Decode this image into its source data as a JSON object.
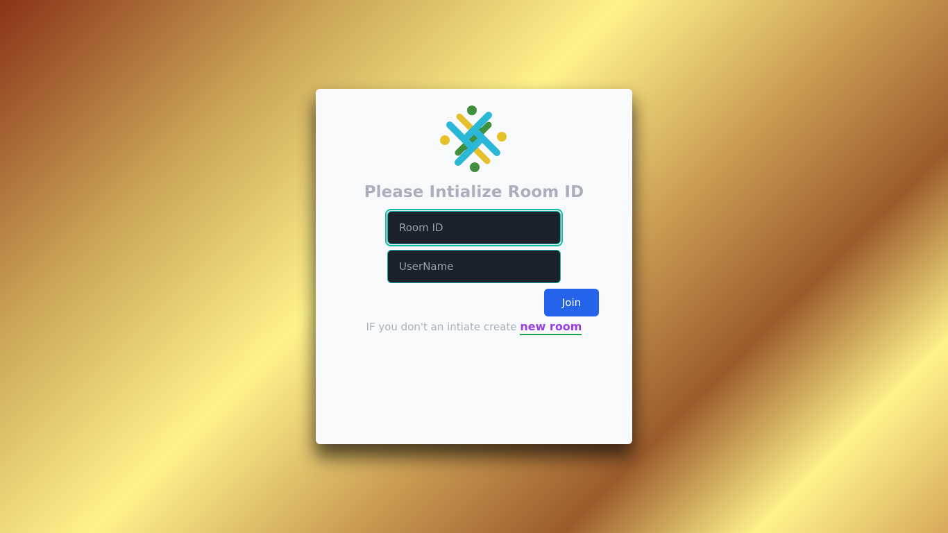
{
  "card": {
    "title": "Please Intialize Room ID",
    "room_id_placeholder": "Room ID",
    "username_placeholder": "UserName",
    "join_label": "Join",
    "hint_text": "IF you don't an intiate create",
    "hint_link": "new room"
  },
  "logo": {
    "icon": "people-circle-logo-icon",
    "colors": {
      "blue": "#2bb7d6",
      "green": "#3f8f3f",
      "yellow": "#e6c02a"
    }
  },
  "colors": {
    "button": "#2563eb",
    "input_bg": "#1b222c",
    "focus_ring": "#14b8a6",
    "link": "#9b3fe0",
    "link_underline": "#16a34a",
    "muted_text": "#a9afbd"
  }
}
